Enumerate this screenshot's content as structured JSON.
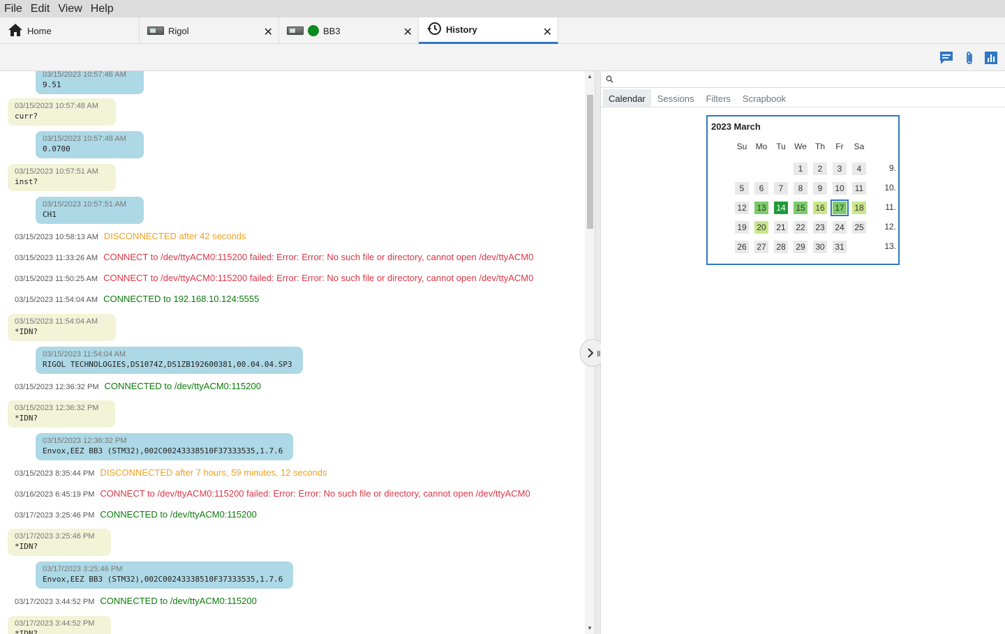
{
  "menu": [
    "File",
    "Edit",
    "View",
    "Help"
  ],
  "tabs": [
    {
      "label": "Home",
      "icon": "home-icon"
    },
    {
      "label": "Rigol",
      "icon": "instrument-icon"
    },
    {
      "label": "BB3",
      "icon": "instrument-icon"
    },
    {
      "label": "History",
      "icon": "history-icon"
    }
  ],
  "toolbar": {
    "icons": [
      "comment-icon",
      "paperclip-icon",
      "chart-icon"
    ]
  },
  "history": {
    "entries": [
      {
        "kind": "resp",
        "ts": "03/15/2023 10:57:46 AM",
        "text": "9.51"
      },
      {
        "kind": "req",
        "ts": "03/15/2023 10:57:48 AM",
        "text": "curr?"
      },
      {
        "kind": "resp",
        "ts": "03/15/2023 10:57:48 AM",
        "text": "0.0700"
      },
      {
        "kind": "req",
        "ts": "03/15/2023 10:57:51 AM",
        "text": "inst?"
      },
      {
        "kind": "resp",
        "ts": "03/15/2023 10:57:51 AM",
        "text": "CH1"
      },
      {
        "kind": "line",
        "ts": "03/15/2023 10:58:13 AM",
        "text": "DISCONNECTED after 42 seconds",
        "color": "orange"
      },
      {
        "kind": "line",
        "ts": "03/15/2023 11:33:26 AM",
        "text": "CONNECT to /dev/ttyACM0:115200 failed: Error: Error: No such file or directory, cannot open /dev/ttyACM0",
        "color": "red"
      },
      {
        "kind": "line",
        "ts": "03/15/2023 11:50:25 AM",
        "text": "CONNECT to /dev/ttyACM0:115200 failed: Error: Error: No such file or directory, cannot open /dev/ttyACM0",
        "color": "red"
      },
      {
        "kind": "line",
        "ts": "03/15/2023 11:54:04 AM",
        "text": "CONNECTED to 192.168.10.124:5555",
        "color": "green"
      },
      {
        "kind": "req",
        "ts": "03/15/2023 11:54:04 AM",
        "text": "*IDN?"
      },
      {
        "kind": "resp",
        "ts": "03/15/2023 11:54:04 AM",
        "text": "RIGOL TECHNOLOGIES,DS1074Z,DS1ZB192600381,00.04.04.SP3"
      },
      {
        "kind": "line",
        "ts": "03/15/2023 12:36:32 PM",
        "text": "CONNECTED to /dev/ttyACM0:115200",
        "color": "green"
      },
      {
        "kind": "req",
        "ts": "03/15/2023 12:36:32 PM",
        "text": "*IDN?"
      },
      {
        "kind": "resp",
        "ts": "03/15/2023 12:36:32 PM",
        "text": "Envox,EEZ BB3 (STM32),002C00243338510F37333535,1.7.6"
      },
      {
        "kind": "line",
        "ts": "03/15/2023 8:35:44 PM",
        "text": "DISCONNECTED after 7 hours, 59 minutes, 12 seconds",
        "color": "orange"
      },
      {
        "kind": "line",
        "ts": "03/16/2023 6:45:19 PM",
        "text": "CONNECT to /dev/ttyACM0:115200 failed: Error: Error: No such file or directory, cannot open /dev/ttyACM0",
        "color": "red"
      },
      {
        "kind": "line",
        "ts": "03/17/2023 3:25:46 PM",
        "text": "CONNECTED to /dev/ttyACM0:115200",
        "color": "green"
      },
      {
        "kind": "req",
        "ts": "03/17/2023 3:25:46 PM",
        "text": "*IDN?"
      },
      {
        "kind": "resp",
        "ts": "03/17/2023 3:25:46 PM",
        "text": "Envox,EEZ BB3 (STM32),002C00243338510F37333535,1.7.6"
      },
      {
        "kind": "line",
        "ts": "03/17/2023 3:44:52 PM",
        "text": "CONNECTED to /dev/ttyACM0:115200",
        "color": "green"
      },
      {
        "kind": "req",
        "ts": "03/17/2023 3:44:52 PM",
        "text": "*IDN?"
      }
    ]
  },
  "right_tabs": [
    "Calendar",
    "Sessions",
    "Filters",
    "Scrapbook"
  ],
  "calendar": {
    "title": "2023 March",
    "weekdays": [
      "Su",
      "Mo",
      "Tu",
      "We",
      "Th",
      "Fr",
      "Sa"
    ],
    "weeks": [
      {
        "num": "9.",
        "days": [
          "",
          "",
          "",
          "1",
          "2",
          "3",
          "4"
        ]
      },
      {
        "num": "10.",
        "days": [
          "5",
          "6",
          "7",
          "8",
          "9",
          "10",
          "11"
        ]
      },
      {
        "num": "11.",
        "days": [
          "12",
          "13",
          "14",
          "15",
          "16",
          "17",
          "18"
        ]
      },
      {
        "num": "12.",
        "days": [
          "19",
          "20",
          "21",
          "22",
          "23",
          "24",
          "25"
        ]
      },
      {
        "num": "13.",
        "days": [
          "26",
          "27",
          "28",
          "29",
          "30",
          "31",
          ""
        ]
      }
    ],
    "activity": {
      "13": 2,
      "14": 3,
      "15": 2,
      "16": 1,
      "17": 2,
      "18": 1,
      "20": 1
    },
    "selected_day": "17"
  },
  "colors": {
    "accent": "#2f76c4",
    "request_bubble": "#f3f3d8",
    "response_bubble": "#add8e6",
    "error": "#dc3545",
    "warning": "#f0a020",
    "ok": "#0b7a0b"
  }
}
